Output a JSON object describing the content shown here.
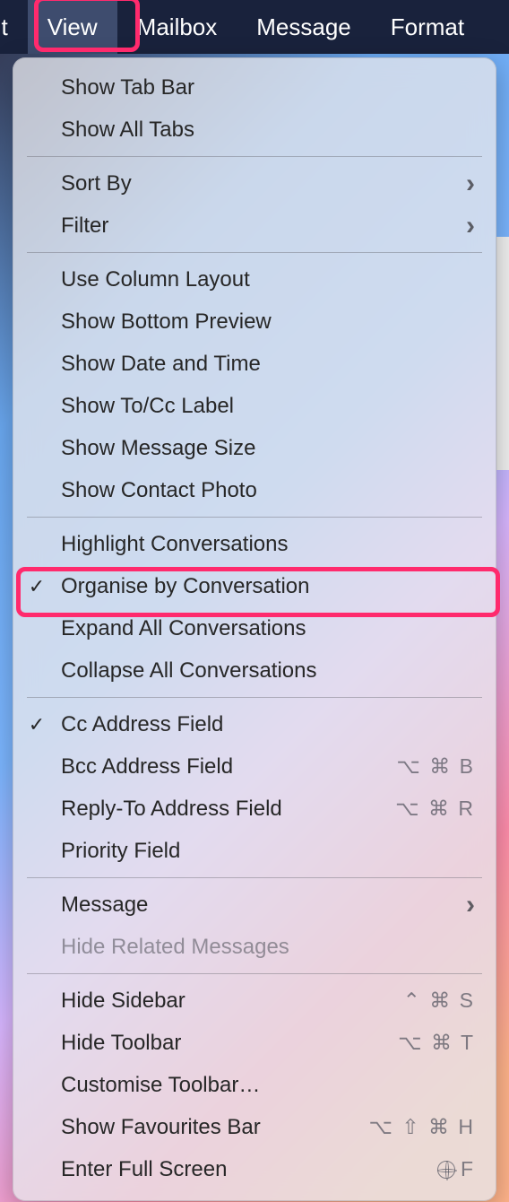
{
  "menubar": {
    "items": [
      {
        "label": "lit"
      },
      {
        "label": "View"
      },
      {
        "label": "Mailbox"
      },
      {
        "label": "Message"
      },
      {
        "label": "Format"
      }
    ],
    "active_index": 1
  },
  "dropdown": {
    "sections": [
      {
        "items": [
          {
            "label": "Show Tab Bar",
            "checked": false,
            "submenu": false,
            "shortcut": "",
            "disabled": false
          },
          {
            "label": "Show All Tabs",
            "checked": false,
            "submenu": false,
            "shortcut": "",
            "disabled": false
          }
        ]
      },
      {
        "items": [
          {
            "label": "Sort By",
            "checked": false,
            "submenu": true,
            "shortcut": "",
            "disabled": false
          },
          {
            "label": "Filter",
            "checked": false,
            "submenu": true,
            "shortcut": "",
            "disabled": false
          }
        ]
      },
      {
        "items": [
          {
            "label": "Use Column Layout",
            "checked": false,
            "submenu": false,
            "shortcut": "",
            "disabled": false
          },
          {
            "label": "Show Bottom Preview",
            "checked": false,
            "submenu": false,
            "shortcut": "",
            "disabled": false
          },
          {
            "label": "Show Date and Time",
            "checked": false,
            "submenu": false,
            "shortcut": "",
            "disabled": false
          },
          {
            "label": "Show To/Cc Label",
            "checked": false,
            "submenu": false,
            "shortcut": "",
            "disabled": false
          },
          {
            "label": "Show Message Size",
            "checked": false,
            "submenu": false,
            "shortcut": "",
            "disabled": false
          },
          {
            "label": "Show Contact Photo",
            "checked": false,
            "submenu": false,
            "shortcut": "",
            "disabled": false
          }
        ]
      },
      {
        "items": [
          {
            "label": "Highlight Conversations",
            "checked": false,
            "submenu": false,
            "shortcut": "",
            "disabled": false
          },
          {
            "label": "Organise by Conversation",
            "checked": true,
            "submenu": false,
            "shortcut": "",
            "disabled": false
          },
          {
            "label": "Expand All Conversations",
            "checked": false,
            "submenu": false,
            "shortcut": "",
            "disabled": false
          },
          {
            "label": "Collapse All Conversations",
            "checked": false,
            "submenu": false,
            "shortcut": "",
            "disabled": false
          }
        ]
      },
      {
        "items": [
          {
            "label": "Cc Address Field",
            "checked": true,
            "submenu": false,
            "shortcut": "",
            "disabled": false
          },
          {
            "label": "Bcc Address Field",
            "checked": false,
            "submenu": false,
            "shortcut": "⌥ ⌘ B",
            "disabled": false
          },
          {
            "label": "Reply-To Address Field",
            "checked": false,
            "submenu": false,
            "shortcut": "⌥ ⌘ R",
            "disabled": false
          },
          {
            "label": "Priority Field",
            "checked": false,
            "submenu": false,
            "shortcut": "",
            "disabled": false
          }
        ]
      },
      {
        "items": [
          {
            "label": "Message",
            "checked": false,
            "submenu": true,
            "shortcut": "",
            "disabled": false
          },
          {
            "label": "Hide Related Messages",
            "checked": false,
            "submenu": false,
            "shortcut": "",
            "disabled": true
          }
        ]
      },
      {
        "items": [
          {
            "label": "Hide Sidebar",
            "checked": false,
            "submenu": false,
            "shortcut": "⌃ ⌘ S",
            "disabled": false
          },
          {
            "label": "Hide Toolbar",
            "checked": false,
            "submenu": false,
            "shortcut": "⌥ ⌘ T",
            "disabled": false
          },
          {
            "label": "Customise Toolbar…",
            "checked": false,
            "submenu": false,
            "shortcut": "",
            "disabled": false
          },
          {
            "label": "Show Favourites Bar",
            "checked": false,
            "submenu": false,
            "shortcut": "⌥ ⇧ ⌘ H",
            "disabled": false
          },
          {
            "label": "Enter Full Screen",
            "checked": false,
            "submenu": false,
            "shortcut": "globe F",
            "disabled": false
          }
        ]
      }
    ]
  },
  "annotations": {
    "highlight_menubar_item": "View",
    "highlight_menu_item": "Organise by Conversation"
  }
}
